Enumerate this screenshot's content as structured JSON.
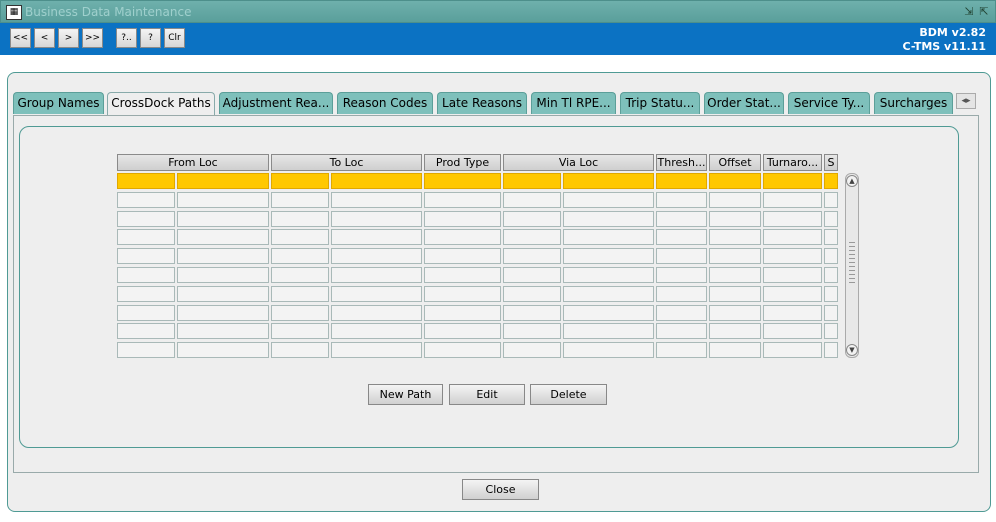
{
  "window": {
    "title": "Business Data Maintenance",
    "app_icon": "app-logo-icon"
  },
  "toolbar": {
    "buttons": [
      "<<",
      "<",
      ">",
      ">>",
      "?..",
      "?",
      "Clr"
    ],
    "version_line1": "BDM v2.82",
    "version_line2": "C-TMS v11.11"
  },
  "tabs": [
    "Group Names",
    "CrossDock Paths",
    "Adjustment Rea...",
    "Reason Codes",
    "Late Reasons",
    "Min Tl RPE...",
    "Trip Statu...",
    "Order Stat...",
    "Service Ty...",
    "Surcharges"
  ],
  "active_tab": "CrossDock Paths",
  "grid": {
    "columns": [
      "From Loc",
      "To Loc",
      "Prod Type",
      "Via Loc",
      "Thresh...",
      "Offset",
      "Turnaro...",
      "S"
    ],
    "row_count": 10,
    "selected_row": 0
  },
  "actions": {
    "new_path": "New Path",
    "edit": "Edit",
    "delete": "Delete"
  },
  "footer": {
    "close": "Close"
  },
  "colors": {
    "accent": "#0b72c3",
    "selection": "#ffc800",
    "tab": "#7ec0bb",
    "border": "#4f9a94"
  }
}
